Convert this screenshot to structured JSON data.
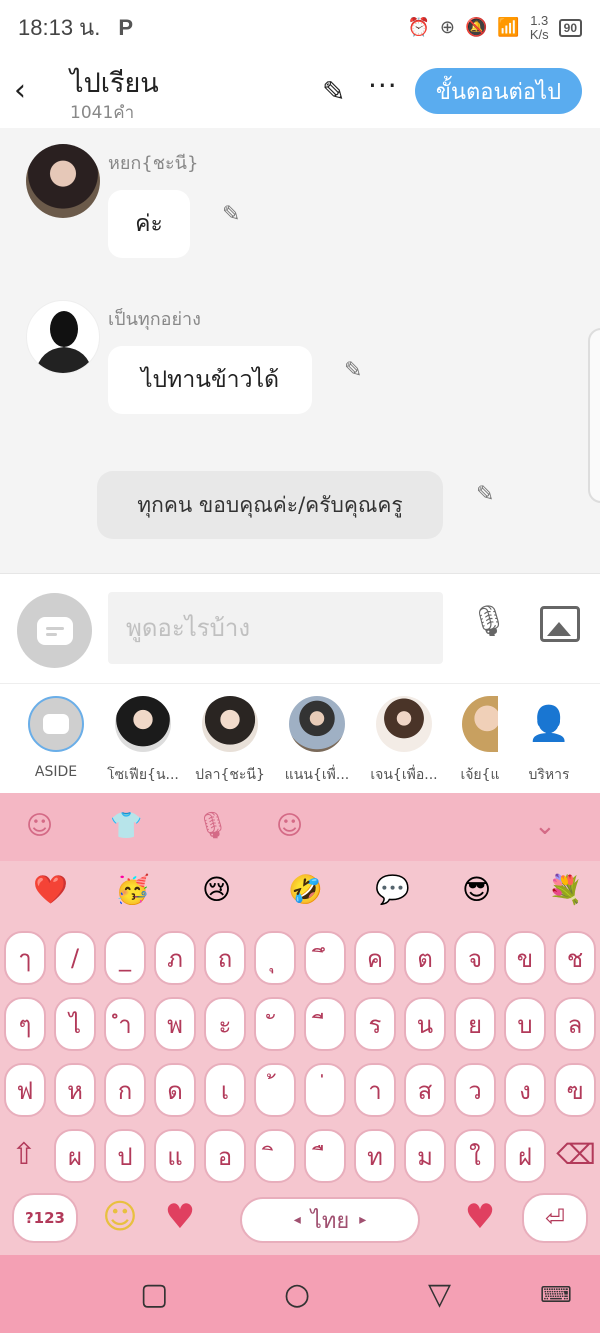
{
  "status": {
    "time": "18:13 น.",
    "p_icon": "P",
    "speed": "1.3\nK/s",
    "battery": "90"
  },
  "header": {
    "title": "ไปเรียน",
    "subtitle": "1041คำ",
    "next_label": "ขั้นตอนต่อไป"
  },
  "chat": {
    "messages": [
      {
        "name": "หยก{ชะนี}",
        "text": "ค่ะ"
      },
      {
        "name": "เป็นทุกอย่าง",
        "text": "ไปทานข้าวได้"
      }
    ],
    "narration": "ทุกคน ขอบคุณค่ะ/ครับคุณครู"
  },
  "input": {
    "placeholder": "พูดอะไรบ้าง"
  },
  "characters": [
    {
      "label": "ASIDE"
    },
    {
      "label": "โซเฟีย{น..."
    },
    {
      "label": "ปลา{ชะนี}"
    },
    {
      "label": "แนน{เพื่..."
    },
    {
      "label": "เจน{เพื่อ..."
    },
    {
      "label": "เจ้ย{แ"
    },
    {
      "label": "บริหาร"
    }
  ],
  "keyboard": {
    "emojis": [
      "❤️",
      "🥳",
      "😢",
      "🤣",
      "💬",
      "😎",
      "💐"
    ],
    "row1": [
      "ๅ",
      "/",
      "_",
      "ภ",
      "ถ",
      "ุ",
      "ึ",
      "ค",
      "ต",
      "จ",
      "ข",
      "ช"
    ],
    "row2": [
      "ๆ",
      "ไ",
      "ำ",
      "พ",
      "ะ",
      "ั",
      "ี",
      "ร",
      "น",
      "ย",
      "บ",
      "ล"
    ],
    "row3": [
      "ฟ",
      "ห",
      "ก",
      "ด",
      "เ",
      "้",
      "่",
      "า",
      "ส",
      "ว",
      "ง",
      "ฃ"
    ],
    "row4": [
      "ผ",
      "ป",
      "แ",
      "อ",
      "ิ",
      "ื",
      "ท",
      "ม",
      "ใ",
      "ฝ"
    ],
    "num_key": "?123",
    "space_label": "ไทย"
  }
}
